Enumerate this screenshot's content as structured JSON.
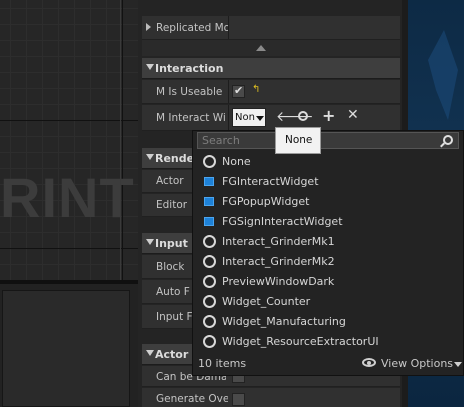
{
  "graph": {
    "watermark": "RINT"
  },
  "details": {
    "replicated_row": {
      "label": "Replicated Mo"
    },
    "interaction": {
      "title": "Interaction",
      "is_useable": {
        "label": "M Is Useable",
        "checked": true
      },
      "interact_widget": {
        "label": "M Interact Wi",
        "value": "Non"
      }
    },
    "rendering": {
      "title": "Rende",
      "rows": [
        "Actor",
        "Editor"
      ]
    },
    "input": {
      "title": "Input",
      "rows": [
        "Block",
        "Auto F",
        "Input F"
      ]
    },
    "actor": {
      "title": "Actor",
      "rows": [
        "Can be Damag",
        "Generate Ove"
      ]
    }
  },
  "tooltip": {
    "text": "None"
  },
  "dropdown": {
    "search_placeholder": "Search",
    "options": [
      {
        "label": "None",
        "icon": "circle-icon"
      },
      {
        "label": "FGInteractWidget",
        "icon": "class-icon"
      },
      {
        "label": "FGPopupWidget",
        "icon": "class-icon"
      },
      {
        "label": "FGSignInteractWidget",
        "icon": "class-icon"
      },
      {
        "label": "Interact_GrinderMk1",
        "icon": "circle-icon"
      },
      {
        "label": "Interact_GrinderMk2",
        "icon": "circle-icon"
      },
      {
        "label": "PreviewWindowDark",
        "icon": "circle-icon"
      },
      {
        "label": "Widget_Counter",
        "icon": "circle-icon"
      },
      {
        "label": "Widget_Manufacturing",
        "icon": "circle-icon"
      },
      {
        "label": "Widget_ResourceExtractorUI",
        "icon": "circle-icon"
      }
    ],
    "item_count": "10 items",
    "view_options": "View Options"
  },
  "colors": {
    "accent_blue": "#1e82d8",
    "panel": "#303030",
    "category": "#3e3e3e"
  }
}
